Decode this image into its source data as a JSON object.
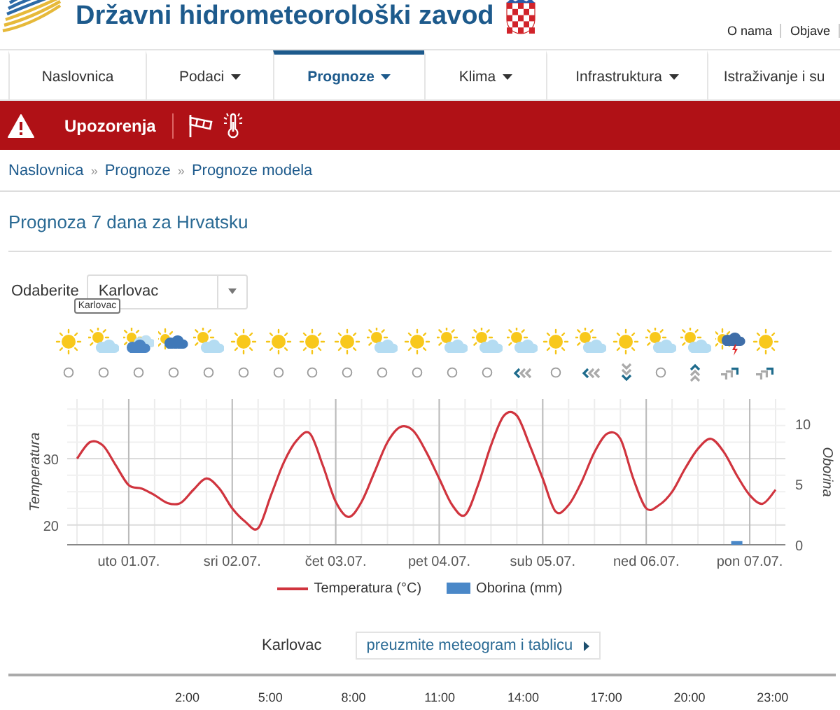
{
  "header": {
    "title": "Državni hidrometeorološki zavod",
    "links": [
      "O nama",
      "Objave"
    ]
  },
  "nav": [
    {
      "label": "Naslovnica",
      "dropdown": false,
      "selected": false
    },
    {
      "label": "Podaci",
      "dropdown": true,
      "selected": false
    },
    {
      "label": "Prognoze",
      "dropdown": true,
      "selected": true
    },
    {
      "label": "Klima",
      "dropdown": true,
      "selected": false
    },
    {
      "label": "Infrastruktura",
      "dropdown": true,
      "selected": false
    },
    {
      "label": "Istraživanje i su",
      "dropdown": false,
      "selected": false
    }
  ],
  "alert_bar": {
    "label": "Upozorenja"
  },
  "breadcrumb": {
    "separator": "»",
    "items": [
      "Naslovnica",
      "Prognoze",
      "Prognoze modela"
    ]
  },
  "heading": "Prognoza 7 dana za Hrvatsku",
  "location_select": {
    "label": "Odaberite",
    "value": "Karlovac"
  },
  "weather_icons": [
    {
      "kind": "sun"
    },
    {
      "kind": "partly-cloudy",
      "tooltip": "Karlovac"
    },
    {
      "kind": "cloudy"
    },
    {
      "kind": "shower"
    },
    {
      "kind": "partly-cloudy"
    },
    {
      "kind": "sun"
    },
    {
      "kind": "sun"
    },
    {
      "kind": "sun"
    },
    {
      "kind": "sun"
    },
    {
      "kind": "partly-cloudy"
    },
    {
      "kind": "sun"
    },
    {
      "kind": "partly-cloudy"
    },
    {
      "kind": "partly-cloudy"
    },
    {
      "kind": "partly-cloudy"
    },
    {
      "kind": "sun"
    },
    {
      "kind": "partly-cloudy"
    },
    {
      "kind": "sun"
    },
    {
      "kind": "partly-cloudy"
    },
    {
      "kind": "partly-cloudy"
    },
    {
      "kind": "storm"
    },
    {
      "kind": "sun"
    }
  ],
  "wind_icons": [
    {
      "kind": "calm"
    },
    {
      "kind": "calm"
    },
    {
      "kind": "calm"
    },
    {
      "kind": "calm"
    },
    {
      "kind": "calm"
    },
    {
      "kind": "calm"
    },
    {
      "kind": "calm"
    },
    {
      "kind": "calm"
    },
    {
      "kind": "calm"
    },
    {
      "kind": "calm"
    },
    {
      "kind": "calm"
    },
    {
      "kind": "calm"
    },
    {
      "kind": "calm"
    },
    {
      "kind": "left"
    },
    {
      "kind": "calm"
    },
    {
      "kind": "left"
    },
    {
      "kind": "down"
    },
    {
      "kind": "calm"
    },
    {
      "kind": "up"
    },
    {
      "kind": "up-right"
    },
    {
      "kind": "up-right"
    }
  ],
  "chart_data": {
    "type": "line",
    "ylabel": "Temperatura",
    "y2label": "Oborina",
    "categories": [
      null,
      null,
      null,
      null,
      "uto 01.07.",
      null,
      null,
      null,
      null,
      null,
      null,
      null,
      "sri 02.07.",
      null,
      null,
      null,
      null,
      null,
      null,
      null,
      "čet 03.07.",
      null,
      null,
      null,
      null,
      null,
      null,
      null,
      "pet 04.07.",
      null,
      null,
      null,
      null,
      null,
      null,
      null,
      "sub 05.07.",
      null,
      null,
      null,
      null,
      null,
      null,
      null,
      "ned 06.07.",
      null,
      null,
      null,
      null,
      null,
      null,
      null,
      "pon 07.07.",
      null,
      null
    ],
    "grid": true,
    "ylim": [
      17,
      39
    ],
    "yticks": [
      20,
      30
    ],
    "y2lim": [
      0,
      12
    ],
    "y2ticks": [
      0,
      5,
      10
    ],
    "series": [
      {
        "name": "Temperatura (°C)",
        "color": "#d0343e",
        "values": [
          30,
          32.5,
          32,
          29,
          26,
          25.5,
          24.5,
          23.3,
          23.3,
          25.3,
          27,
          25.5,
          22.5,
          20.5,
          19.5,
          24.5,
          29.5,
          32.8,
          33.8,
          29,
          23.5,
          21.2,
          23.5,
          28,
          32.5,
          34.8,
          34.2,
          31,
          27,
          23,
          21.5,
          26,
          32,
          36.5,
          36.5,
          32,
          27,
          22,
          23,
          26.5,
          31,
          33.8,
          33,
          27,
          22.5,
          23,
          25,
          28.5,
          31.5,
          33,
          31,
          27.5,
          24.5,
          23.2,
          25.3
        ]
      },
      {
        "name": "Oborina (mm)",
        "axis": "y2",
        "marker": "square",
        "color": "#4a88c8",
        "values": [
          null,
          null,
          null,
          null,
          null,
          null,
          null,
          null,
          null,
          null,
          null,
          null,
          null,
          null,
          null,
          null,
          null,
          null,
          null,
          null,
          null,
          null,
          null,
          null,
          null,
          null,
          null,
          null,
          null,
          null,
          null,
          null,
          null,
          null,
          null,
          null,
          null,
          null,
          null,
          null,
          null,
          null,
          null,
          null,
          null,
          null,
          null,
          null,
          null,
          null,
          null,
          0.3,
          null,
          null,
          null
        ]
      }
    ]
  },
  "download": {
    "location": "Karlovac",
    "button": "preuzmite meteogram i tablicu"
  },
  "time_columns": [
    "2:00",
    "5:00",
    "8:00",
    "11:00",
    "14:00",
    "17:00",
    "20:00",
    "23:00"
  ]
}
